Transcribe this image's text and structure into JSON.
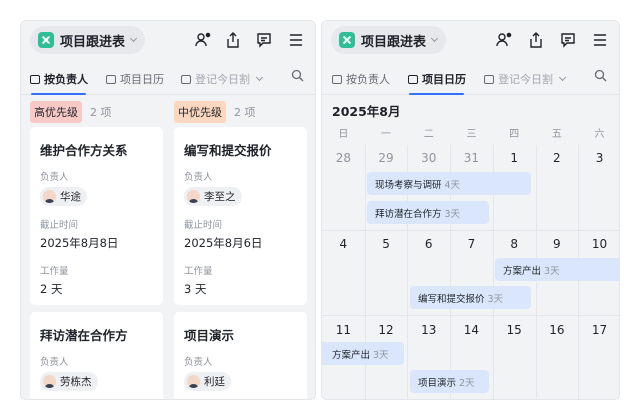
{
  "left": {
    "title": "项目跟进表",
    "tabs": [
      {
        "label": "按负责人",
        "active": true
      },
      {
        "label": "项目日历",
        "active": false
      },
      {
        "label": "登记今日割",
        "active": false
      }
    ],
    "columns": [
      {
        "priority": "高优先级",
        "count": "2 项",
        "color": "#f8c9c6",
        "cards": [
          {
            "title": "维护合作方关系",
            "owner_label": "负责人",
            "owner": "华途",
            "deadline_label": "截止时间",
            "deadline": "2025年8月8日",
            "workload_label": "工作量",
            "workload": "2 天"
          },
          {
            "title": "拜访潜在合作方",
            "owner_label": "负责人",
            "owner": "劳栋杰"
          }
        ]
      },
      {
        "priority": "中优先级",
        "count": "2 项",
        "color": "#fbd7bf",
        "cards": [
          {
            "title": "编写和提交报价",
            "owner_label": "负责人",
            "owner": "李至之",
            "deadline_label": "截止时间",
            "deadline": "2025年8月6日",
            "workload_label": "工作量",
            "workload": "3 天"
          },
          {
            "title": "项目演示",
            "owner_label": "负责人",
            "owner": "利廷"
          }
        ]
      }
    ]
  },
  "right": {
    "title": "项目跟进表",
    "tabs": [
      {
        "label": "按负责人",
        "active": false
      },
      {
        "label": "项目日历",
        "active": true
      },
      {
        "label": "登记今日割",
        "active": false
      }
    ],
    "month": "2025年8月",
    "weekdays": [
      "日",
      "一",
      "二",
      "三",
      "四",
      "五",
      "六"
    ],
    "weeks": [
      [
        "28",
        "29",
        "30",
        "31",
        "1",
        "2",
        "3"
      ],
      [
        "4",
        "5",
        "6",
        "7",
        "8",
        "9",
        "10"
      ],
      [
        "11",
        "12",
        "13",
        "14",
        "15",
        "16",
        "17"
      ]
    ],
    "events": [
      {
        "name": "现场考察与调研",
        "duration": "4天"
      },
      {
        "name": "拜访潜在合作方",
        "duration": "3天"
      },
      {
        "name": "方案产出",
        "duration": "3天"
      },
      {
        "name": "编写和提交报价",
        "duration": "3天"
      },
      {
        "name": "方案产出",
        "duration": "3天"
      },
      {
        "name": "项目演示",
        "duration": "2天"
      }
    ]
  },
  "colors": {
    "accent": "#3370ff",
    "event": "#d9e6fb",
    "logo": "#2fbf97"
  },
  "icons": [
    "app-logo-icon",
    "user-notify-icon",
    "share-icon",
    "comment-icon",
    "menu-icon",
    "board-icon",
    "calendar-icon",
    "form-icon",
    "chevron-down-icon",
    "search-icon"
  ]
}
